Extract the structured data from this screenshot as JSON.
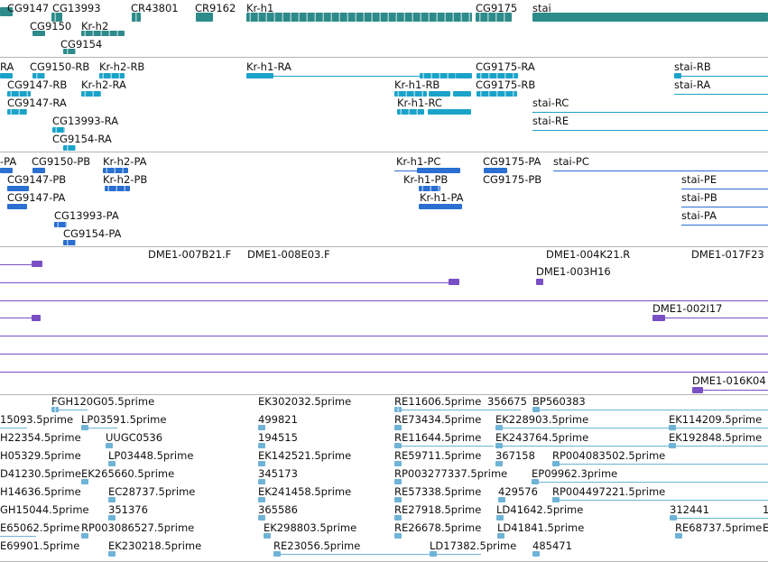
{
  "colors": {
    "gene": "#2e8b8b",
    "transcript": "#1aa3c9",
    "protein": "#2a6fd1",
    "clone": "#7a4fc4",
    "est": "#6fb3d6"
  },
  "tracks": {
    "genes": {
      "name": "gene-track",
      "labels": {
        "cg9147": "CG9147",
        "cg13993": "CG13993",
        "cr43801": "CR43801",
        "cr9162": "CR9162",
        "krh1": "Kr-h1",
        "cg9175": "CG9175",
        "stai": "stai",
        "cg9150": "CG9150",
        "krh2": "Kr-h2",
        "cg9154": "CG9154"
      }
    },
    "transcripts": {
      "name": "transcript-track",
      "labels": {
        "ra_cut": "RA",
        "cg9150_rb": "CG9150-RB",
        "krh2_rb": "Kr-h2-RB",
        "krh1_ra": "Kr-h1-RA",
        "cg9175_ra": "CG9175-RA",
        "stai_rb": "stai-RB",
        "cg9147_rb": "CG9147-RB",
        "krh2_ra": "Kr-h2-RA",
        "krh1_rb": "Kr-h1-RB",
        "cg9175_rb": "CG9175-RB",
        "stai_ra": "stai-RA",
        "cg9147_ra": "CG9147-RA",
        "krh1_rc": "Kr-h1-RC",
        "stai_rc": "stai-RC",
        "cg13993_ra": "CG13993-RA",
        "stai_re": "stai-RE",
        "cg9154_ra": "CG9154-RA"
      }
    },
    "proteins": {
      "name": "protein-track",
      "labels": {
        "pa_cut": "-PA",
        "cg9150_pb": "CG9150-PB",
        "krh2_pa": "Kr-h2-PA",
        "krh1_pc": "Kr-h1-PC",
        "cg9175_pa": "CG9175-PA",
        "stai_pc": "stai-PC",
        "cg9147_pb": "CG9147-PB",
        "krh2_pb": "Kr-h2-PB",
        "krh1_pb": "Kr-h1-PB",
        "cg9175_pb": "CG9175-PB",
        "stai_pe": "stai-PE",
        "cg9147_pa": "CG9147-PA",
        "krh1_pa": "Kr-h1-PA",
        "stai_pb": "stai-PB",
        "cg13993_pa": "CG13993-PA",
        "stai_pa": "stai-PA",
        "cg9154_pa": "CG9154-PA"
      }
    },
    "clones": {
      "name": "bac-clone-track",
      "labels": {
        "c007b21": "DME1-007B21.F",
        "c008e03": "DME1-008E03.F",
        "c004k21": "DME1-004K21.R",
        "c017f23": "DME1-017F23",
        "c003h16": "DME1-003H16",
        "c002i17": "DME1-002I17",
        "c016k04": "DME1-016K04"
      }
    },
    "ests": {
      "name": "est-track",
      "labels": {
        "fgh120g05": "FGH120G05.5prime",
        "ek302032": "EK302032.5prime",
        "re11606": "RE11606.5prime",
        "n356675": "356675",
        "bp560383": "BP560383",
        "c15093": "15093.5prime",
        "lp03591": "LP03591.5prime",
        "n499821": "499821",
        "re73434": "RE73434.5prime",
        "ek228903": "EK228903.5prime",
        "ek114209": "EK114209.5prime",
        "h22354": "H22354.5prime",
        "uugc0536": "UUGC0536",
        "n194515": "194515",
        "re11644": "RE11644.5prime",
        "ek243764": "EK243764.5prime",
        "ek192848": "EK192848.5prime",
        "h05329": "H05329.5prime",
        "lp03448": "LP03448.5prime",
        "ek142521": "EK142521.5prime",
        "re59711": "RE59711.5prime",
        "n367158": "367158",
        "rp004083502": "RP004083502.5prime",
        "d41230": "D41230.5prime",
        "ek265660": "EK265660.5prime",
        "n345173": "345173",
        "rp003277337": "RP003277337.5prime",
        "ep09962": "EP09962.3prime",
        "h14636": "H14636.5prime",
        "ec28737": "EC28737.5prime",
        "ek241458": "EK241458.5prime",
        "re57338": "RE57338.5prime",
        "n429576": "429576",
        "rp004497221": "RP004497221.5prime",
        "gh15044": "GH15044.5prime",
        "n351376": "351376",
        "n365586": "365586",
        "re27918": "RE27918.5prime",
        "ld41642": "LD41642.5prime",
        "n312441": "312441",
        "n1": "1",
        "e65062": "E65062.5prime",
        "rp003086527": "RP003086527.5prime",
        "ek298803": "EK298803.5prime",
        "re26678": "RE26678.5prime",
        "ld41841": "LD41841.5prime",
        "re68737": "RE68737.5prime",
        "e_cut": "E",
        "e69901": "E69901.5prime",
        "ek230218": "EK230218.5prime",
        "re23056": "RE23056.5prime",
        "ld17382": "LD17382.5prime",
        "n485471": "485471"
      }
    }
  }
}
